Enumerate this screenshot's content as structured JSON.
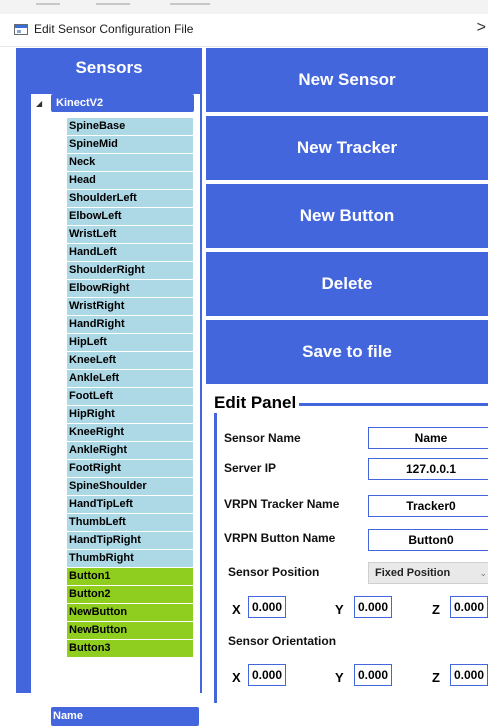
{
  "window": {
    "title": "Edit Sensor Configuration File",
    "overflow_glyph": ">"
  },
  "sidebar": {
    "header": "Sensors",
    "sensors": [
      {
        "name": "KinectV2",
        "expanded": true,
        "expand_glyph": "◢",
        "joints": [
          "SpineBase",
          "SpineMid",
          "Neck",
          "Head",
          "ShoulderLeft",
          "ElbowLeft",
          "WristLeft",
          "HandLeft",
          "ShoulderRight",
          "ElbowRight",
          "WristRight",
          "HandRight",
          "HipLeft",
          "KneeLeft",
          "AnkleLeft",
          "FootLeft",
          "HipRight",
          "KneeRight",
          "AnkleRight",
          "FootRight",
          "SpineShoulder",
          "HandTipLeft",
          "ThumbLeft",
          "HandTipRight",
          "ThumbRight"
        ],
        "buttons": [
          "Button1",
          "Button2",
          "NewButton",
          "NewButton",
          "Button3"
        ]
      },
      {
        "name": "Name"
      }
    ]
  },
  "actions": {
    "new_sensor": "New Sensor",
    "new_tracker": "New Tracker",
    "new_button": "New Button",
    "delete": "Delete",
    "save": "Save to file"
  },
  "edit_panel": {
    "title": "Edit Panel",
    "sensor_name": {
      "label": "Sensor Name",
      "value": "Name"
    },
    "server_ip": {
      "label": "Server IP",
      "value": "127.0.0.1"
    },
    "tracker_name": {
      "label": "VRPN Tracker Name",
      "value": "Tracker0"
    },
    "button_name": {
      "label": "VRPN Button Name",
      "value": "Button0"
    },
    "position": {
      "label": "Sensor Position",
      "mode": "Fixed Position",
      "x_label": "X",
      "y_label": "Y",
      "z_label": "Z",
      "x": "0.000",
      "y": "0.000",
      "z": "0.000"
    },
    "orientation": {
      "label": "Sensor Orientation",
      "x_label": "X",
      "y_label": "Y",
      "z_label": "Z",
      "x": "0.000",
      "y": "0.000",
      "z": "0.000"
    }
  },
  "colors": {
    "accent": "#4466dd",
    "joint": "#add8e6",
    "button": "#8fce1e"
  }
}
